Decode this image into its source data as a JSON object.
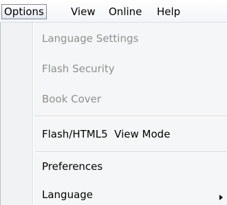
{
  "menubar": {
    "items": [
      {
        "label": "Options",
        "active": true
      },
      {
        "label": "View"
      },
      {
        "label": "Online"
      },
      {
        "label": "Help"
      }
    ]
  },
  "options_menu": {
    "items": [
      {
        "label": "Language Settings",
        "enabled": false
      },
      {
        "label": "Flash Security",
        "enabled": false
      },
      {
        "label": "Book Cover",
        "enabled": false
      },
      {
        "label": "Flash/HTML5  View Mode",
        "enabled": true
      },
      {
        "label": "Preferences",
        "enabled": true
      },
      {
        "label": "Language",
        "enabled": true,
        "submenu": true
      }
    ]
  },
  "icons": {
    "submenu_indicator": "triangle-right-icon"
  },
  "colors": {
    "disabled_text": "#8f8f8f",
    "menu_background": "#f5f6f7",
    "active_border": "#7f8a99"
  }
}
